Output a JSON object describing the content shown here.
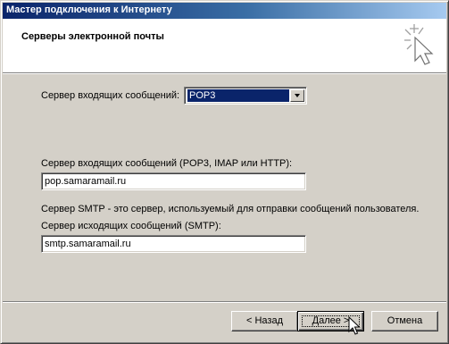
{
  "window": {
    "title": "Мастер подключения к Интернету"
  },
  "header": {
    "heading": "Серверы электронной почты",
    "logo_icon": "wizard-sparkle-icon"
  },
  "incoming_type": {
    "label": "Сервер входящих сообщений:",
    "selected": "POP3"
  },
  "incoming_server": {
    "label": "Сервер входящих сообщений (POP3, IMAP или HTTP):",
    "value": "pop.samaramail.ru"
  },
  "smtp_note": "Сервер SMTP - это сервер, используемый для отправки сообщений  пользователя.",
  "outgoing_server": {
    "label": "Сервер исходящих сообщений (SMTP):",
    "value": "smtp.samaramail.ru"
  },
  "buttons": {
    "back": "< Назад",
    "next": "Далее >",
    "cancel": "Отмена"
  },
  "colors": {
    "face": "#d4d0c8",
    "title_start": "#0a246a",
    "title_end": "#a6caf0",
    "selection": "#0a246a"
  }
}
